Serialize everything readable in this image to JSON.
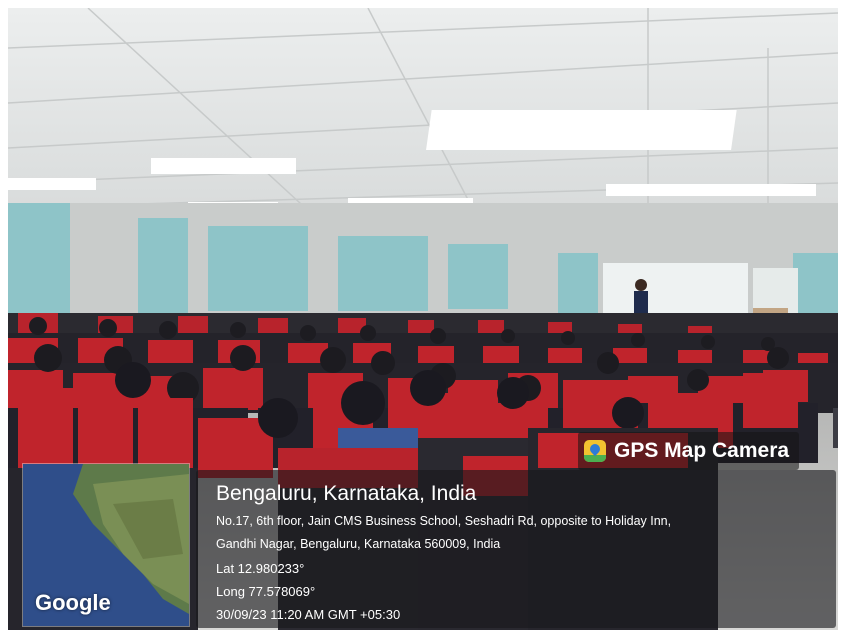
{
  "stamp": {
    "app_name": "GPS Map Camera",
    "city_line": "Bengaluru, Karnataka, India",
    "address_line1": "No.17, 6th floor, Jain CMS Business School, Seshadri Rd, opposite to Holiday Inn,",
    "address_line2": "Gandhi Nagar, Bengaluru, Karnataka 560009, India",
    "lat": "Lat 12.980233°",
    "long": "Long 77.578069°",
    "datetime": "30/09/23 11:20 AM GMT +05:30"
  },
  "map": {
    "brand": "Google"
  },
  "colors": {
    "seat_red": "#c0242c",
    "seat_dark": "#2a2a30",
    "wall_teal": "#8ec4c8",
    "ceiling": "#e4e6e6"
  }
}
